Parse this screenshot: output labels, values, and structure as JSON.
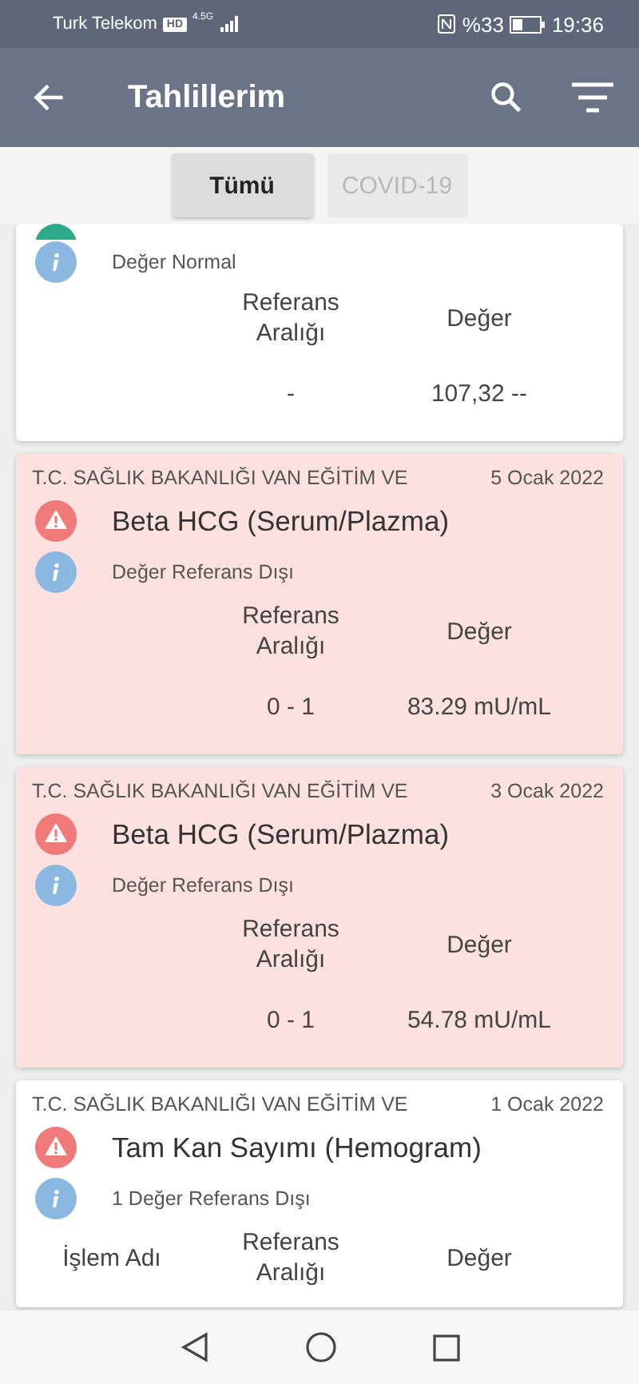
{
  "status_bar": {
    "carrier": "Turk Telekom",
    "hd_badge": "HD",
    "network": "4.5G",
    "battery": "%33",
    "time": "19:36"
  },
  "app_bar": {
    "title": "Tahlillerim"
  },
  "filters": [
    {
      "label": "Tümü",
      "selected": true
    },
    {
      "label": "COVID-19",
      "selected": false
    }
  ],
  "results": [
    {
      "out_of_range": false,
      "highlighted": false,
      "info": "Değer Normal",
      "columns": {
        "reference": "Referans Aralığı",
        "value": "Değer"
      },
      "rows": [
        {
          "reference": "-",
          "value": "107,32 --"
        }
      ]
    },
    {
      "out_of_range": true,
      "institution": "T.C. SAĞLIK BAKANLIĞI VAN EĞİTİM VE",
      "highlighted": true,
      "date": "5 Ocak 2022",
      "title": "Beta HCG (Serum/Plazma)",
      "info": "Değer Referans Dışı",
      "columns": {
        "reference": "Referans Aralığı",
        "value": "Değer"
      },
      "rows": [
        {
          "reference": "0 - 1",
          "value": "83.29 mU/mL"
        }
      ]
    },
    {
      "out_of_range": true,
      "institution": "T.C. SAĞLIK BAKANLIĞI VAN EĞİTİM VE",
      "highlighted": true,
      "date": "3 Ocak 2022",
      "title": "Beta HCG (Serum/Plazma)",
      "info": "Değer Referans Dışı",
      "columns": {
        "reference": "Referans Aralığı",
        "value": "Değer"
      },
      "rows": [
        {
          "reference": "0 - 1",
          "value": "54.78 mU/mL"
        }
      ]
    },
    {
      "out_of_range": true,
      "institution": "T.C. SAĞLIK BAKANLIĞI VAN EĞİTİM VE",
      "highlighted": false,
      "date": "1 Ocak 2022",
      "title": "Tam Kan Sayımı (Hemogram)",
      "info": "1 Değer Referans Dışı",
      "columns": {
        "name": "İşlem Adı",
        "reference": "Referans Aralığı",
        "value": "Değer"
      }
    }
  ]
}
